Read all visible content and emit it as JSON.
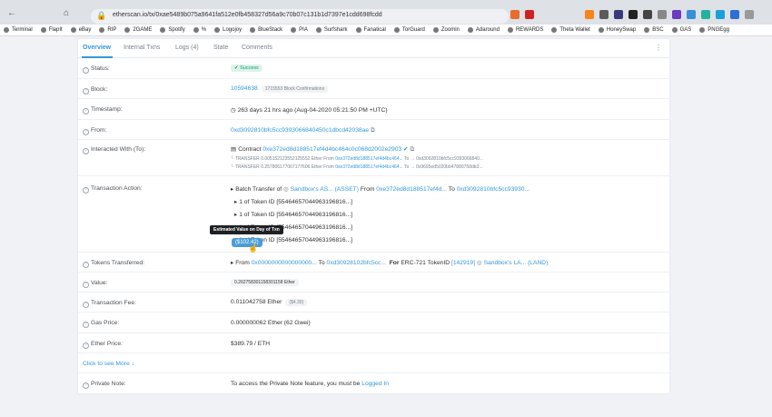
{
  "browser": {
    "url": "etherscan.io/tx/0xae5489b075a9641fa512e0fb458327d56a9c70b07c131b1d7397e1cdd698fcdd",
    "bookmarks": [
      "Terminal",
      "FlapIt",
      "eBay",
      "RIP",
      "2GAME",
      "Spotify",
      "%",
      "Logojoy",
      "BlueStack",
      "PIA",
      "Surfshark",
      "Fanatical",
      "TorGuard",
      "Zoomin",
      "Adaround",
      "REWARDS",
      "Theta Wallet",
      "HoneySwap",
      "BSC",
      "GAS",
      "PNGEgg"
    ]
  },
  "tabs": [
    "Overview",
    "Internal Txns",
    "Logs (4)",
    "State",
    "Comments"
  ],
  "rows": {
    "status": {
      "label": "Status:",
      "value": "Success"
    },
    "block": {
      "label": "Block:",
      "value": "10594638",
      "confirm": "1715553 Block Confirmations"
    },
    "timestamp": {
      "label": "Timestamp:",
      "value": "263 days 21 hrs ago (Aug-04-2020 05:21:50 PM +UTC)"
    },
    "from": {
      "label": "From:",
      "value": "0xd3092810bfc5cc9393066840450c1dbcd42038ae"
    },
    "interacted": {
      "label": "Interacted With (To):",
      "contract_prefix": "Contract",
      "contract": "0xe372ed8d188517ef4d4bc464c0c068d2002e2903",
      "transfers": [
        {
          "text": "TRANSFER  0.005152123552125552 Ether From",
          "from": "0xe372ed8d188517ef4d4bc464...",
          "to": "To → 0xd3092810bfc5cc9393066840..."
        },
        {
          "text": "TRANSFER  0.257806177067177606 Ether From",
          "from": "0xe372ed8d188517ef4d4bc464...",
          "to": "To → 0x9695ed5020bb47889758db3..."
        }
      ]
    },
    "action": {
      "label": "Transaction Action:",
      "line1": "Batch Transfer of",
      "token": "Sandbox's AS... (ASSET)",
      "from_word": "From",
      "from": "0xe372ed8d188517ef4d...",
      "to_word": "To",
      "to": "0xd3092810bfc5cc93930...",
      "items": [
        "1 of Token ID [55464657044963196816...]",
        "1 of Token ID [55464657044963196816...]",
        "1 of Token ID [55464657044963196816...]",
        "1 of Token ID [55464657044963196816...]"
      ]
    },
    "tokens": {
      "label": "Tokens Transferred:",
      "from_word": "From",
      "from": "0x0000000000000000...",
      "to_word": "To",
      "to": "0xd30928102bfc5cc...",
      "for_word": "For",
      "erc": "ERC-721 TokenID",
      "tokenid": "[142919]",
      "token": "Sandbox's LA... (LAND)"
    },
    "value": {
      "label": "Value:",
      "amount": "0.262758301158301158 Ether",
      "price": "($102.42)",
      "tooltip": "Estimated Value on Day of Txn"
    },
    "fee": {
      "label": "Transaction Fee:",
      "amount": "0.011042758 Ether",
      "usd": "($4.30)"
    },
    "gas": {
      "label": "Gas Price:",
      "value": "0.000000062 Ether (62 Gwei)"
    },
    "ether": {
      "label": "Ether Price:",
      "value": "$389.79 / ETH"
    },
    "more": {
      "label": "Click to see More"
    },
    "note": {
      "label": "Private Note:",
      "text": "To access the Private Note feature, you must be",
      "login": "Logged In"
    }
  }
}
